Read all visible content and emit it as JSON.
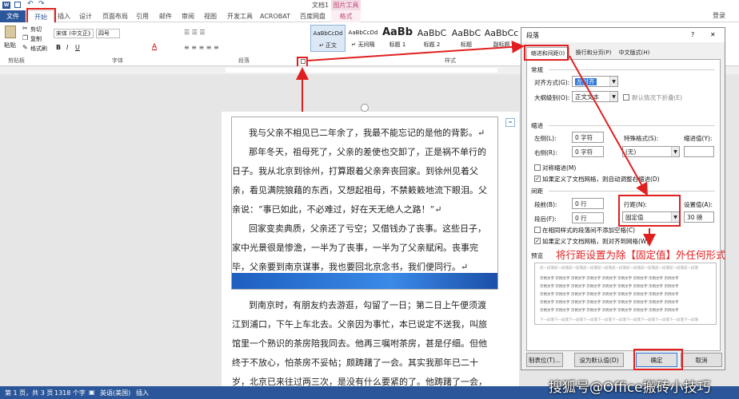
{
  "title_bar": {
    "doc_title": "文档1 - Word",
    "context_tab_label": "图片工具"
  },
  "ribbon_tabs": [
    "文件",
    "开始",
    "插入",
    "设计",
    "页面布局",
    "引用",
    "邮件",
    "审阅",
    "视图",
    "开发工具",
    "ACROBAT",
    "百度网盘",
    "格式"
  ],
  "login_label": "登录",
  "ribbon": {
    "clipboard": {
      "paste": "粘贴",
      "cut": "剪切",
      "copy": "复制",
      "painter": "格式刷",
      "group": "剪贴板"
    },
    "font": {
      "name": "宋体 (中文正》",
      "size": "四号",
      "group": "字体"
    },
    "paragraph_group": "段落",
    "styles_group": "样式",
    "styles": [
      {
        "sample": "AaBbCcDd",
        "name": "↵ 正文"
      },
      {
        "sample": "AaBbCcDd",
        "name": "↵ 无间隔"
      },
      {
        "sample": "AaBb",
        "name": "标题 1"
      },
      {
        "sample": "AaBbC",
        "name": "标题 2"
      },
      {
        "sample": "AaBbC",
        "name": "标题"
      },
      {
        "sample": "AaBbCc",
        "name": "副标题"
      }
    ]
  },
  "document": {
    "lines": [
      "我与父亲不相见已二年余了，我最不能忘记的是他的背影。↵",
      "那年冬天，祖母死了，父亲的差使也交卸了，正是祸不单行的",
      "日子。我从北京到徐州，打算跟着父亲奔丧回家。到徐州见着父",
      "亲，看见满院狼藉的东西，又想起祖母，不禁簌簌地流下眼泪。父",
      "亲说：“事已如此，不必难过，好在天无绝人之路！”↵",
      "回家变卖典质，父亲还了亏空；又借钱办了丧事。这些日子，",
      "家中光景很是惨澹，一半为了丧事，一半为了父亲赋闲。丧事完",
      "毕，父亲要到南京谋事，我也要回北京念书，我们便同行。↵",
      "到南京时，有朋友约去游逛，勾留了一日；第二日上午便须渡",
      "江到浦口，下午上车北去。父亲因为事忙，本已说定不送我，叫旅",
      "馆里一个熟识的茶房陪我同去。他再三嘱咐茶房，甚是仔细。但他",
      "终于不放心，怕茶房不妥帖；颇踌躇了一会。其实我那年已二十",
      "岁，北京已来往过两三次，是没有什么要紧的了。他踌躇了一会，"
    ]
  },
  "status": {
    "page": "第 1 页，共 3 页",
    "words": "1318 个字",
    "lang": "英语(美国)",
    "mode": "插入"
  },
  "watermark": "搜狐号@Office搬砖小技巧",
  "dialog": {
    "title": "段落",
    "help": "?",
    "close": "✕",
    "tabs": [
      "缩进和间距(I)",
      "换行和分页(P)",
      "中文版式(H)"
    ],
    "general": {
      "heading": "常规",
      "align_label": "对齐方式(G):",
      "align_value": "左对齐",
      "outline_label": "大纲级别(O):",
      "outline_value": "正文文本",
      "collapse_label": "默认情况下折叠(E)"
    },
    "indent": {
      "heading": "缩进",
      "left_label": "左侧(L):",
      "left_value": "0 字符",
      "right_label": "右侧(R):",
      "right_value": "0 字符",
      "special_label": "特殊格式(S):",
      "special_value": "(无)",
      "by_label": "缩进值(Y):",
      "mirror_label": "对称缩进(M)",
      "auto_label": "如果定义了文档网格，则自动调整右缩进(D)"
    },
    "spacing": {
      "heading": "间距",
      "before_label": "段前(B):",
      "before_value": "0 行",
      "after_label": "段后(F):",
      "after_value": "0 行",
      "line_label": "行距(N):",
      "line_value": "固定值",
      "at_label": "设置值(A):",
      "at_value": "30 磅",
      "nospace_label": "在相同样式的段落间不添加空格(C)",
      "grid_label": "如果定义了文档网格，则对齐到网格(W)"
    },
    "preview_heading": "预览",
    "preview_lines": [
      "前一段落前一段落前一段落前一段落前一段落前一段落前一段落前一段落前一段落前一段落前一段落",
      "示例文字 示例文字 示例文字 示例文字 示例文字 示例文字 示例文字 示例文字 示例文字",
      "示例文字 示例文字 示例文字 示例文字 示例文字 示例文字 示例文字 示例文字 示例文字",
      "示例文字 示例文字 示例文字 示例文字 示例文字 示例文字 示例文字 示例文字 示例文字",
      "示例文字 示例文字 示例文字 示例文字 示例文字 示例文字 示例文字 示例文字 示例文字",
      "示例文字 示例文字 示例文字 示例文字 示例文字 示例文字 示例文字 示例文字 示例文字",
      "下一段落下一段落下一段落下一段落下一段落下一段落下一段落下一段落下一段落下一段落下一段落"
    ],
    "buttons": {
      "tab_stops": "制表位(T)...",
      "set_default": "设为默认值(D)",
      "ok": "确定",
      "cancel": "取消"
    }
  },
  "annotation": "将行距设置为除【固定值】外任何形式",
  "colors": {
    "word_blue": "#2b579a",
    "annotation_red": "#e02020",
    "picture_tools": "#c24c7b"
  }
}
